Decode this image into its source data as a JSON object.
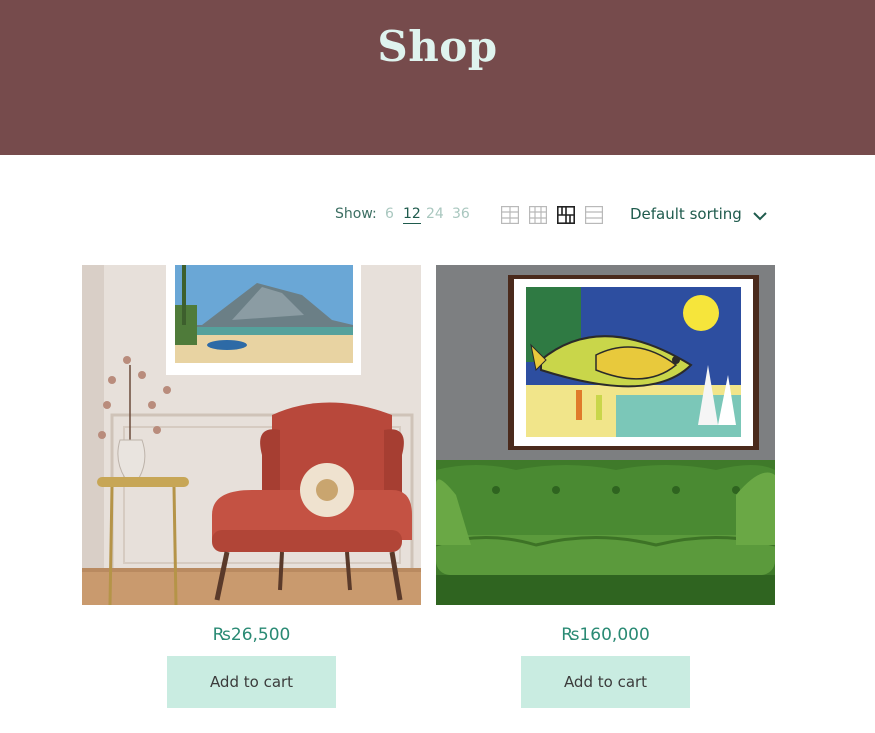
{
  "header": {
    "title": "Shop"
  },
  "toolbar": {
    "show_label": "Show:",
    "show_options": [
      "6",
      "12",
      "24",
      "36"
    ],
    "show_selected": "12",
    "view_icons": [
      "grid-2-icon",
      "grid-3-icon",
      "grid-4-icon",
      "list-view-icon"
    ],
    "sort_label": "Default sorting"
  },
  "products": [
    {
      "price": "₨26,500",
      "button": "Add to cart",
      "image": "landscape-painting-above-armchair"
    },
    {
      "price": "₨160,000",
      "button": "Add to cart",
      "image": "fish-painting-above-green-sofa"
    }
  ],
  "colors": {
    "hero": "#764b4c",
    "hero_text": "#dff3ee",
    "accent": "#2a8a74",
    "button_bg": "#c9ece1"
  }
}
